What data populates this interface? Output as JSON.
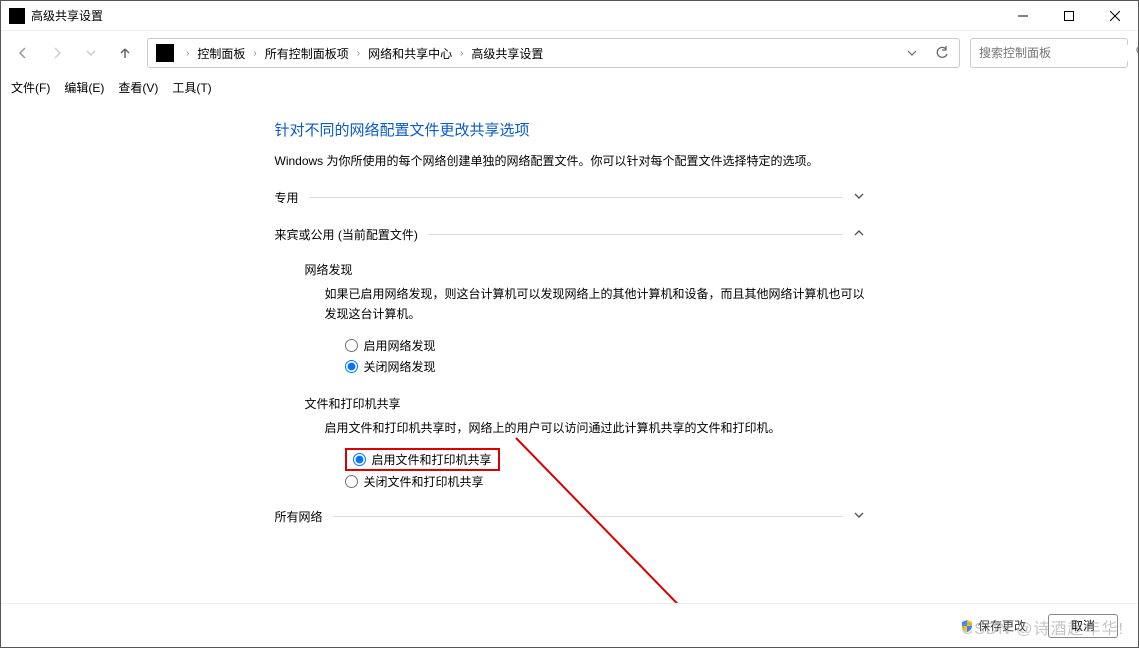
{
  "titlebar": {
    "title": "高级共享设置"
  },
  "breadcrumb": {
    "items": [
      "控制面板",
      "所有控制面板项",
      "网络和共享中心",
      "高级共享设置"
    ]
  },
  "search": {
    "placeholder": "搜索控制面板"
  },
  "menubar": {
    "file": "文件(F)",
    "edit": "编辑(E)",
    "view": "查看(V)",
    "tools": "工具(T)"
  },
  "page": {
    "title": "针对不同的网络配置文件更改共享选项",
    "desc": "Windows 为你所使用的每个网络创建单独的网络配置文件。你可以针对每个配置文件选择特定的选项。"
  },
  "sections": {
    "private": {
      "label": "专用"
    },
    "guest": {
      "label": "来宾或公用 (当前配置文件)",
      "discovery": {
        "label": "网络发现",
        "desc": "如果已启用网络发现，则这台计算机可以发现网络上的其他计算机和设备，而且其他网络计算机也可以发现这台计算机。",
        "opt_on": "启用网络发现",
        "opt_off": "关闭网络发现"
      },
      "file_share": {
        "label": "文件和打印机共享",
        "desc": "启用文件和打印机共享时，网络上的用户可以访问通过此计算机共享的文件和打印机。",
        "opt_on": "启用文件和打印机共享",
        "opt_off": "关闭文件和打印机共享"
      }
    },
    "all": {
      "label": "所有网络"
    }
  },
  "footer": {
    "save": "保存更改",
    "cancel": "取消"
  },
  "watermark": "CSDN @诗酒趁年华!"
}
